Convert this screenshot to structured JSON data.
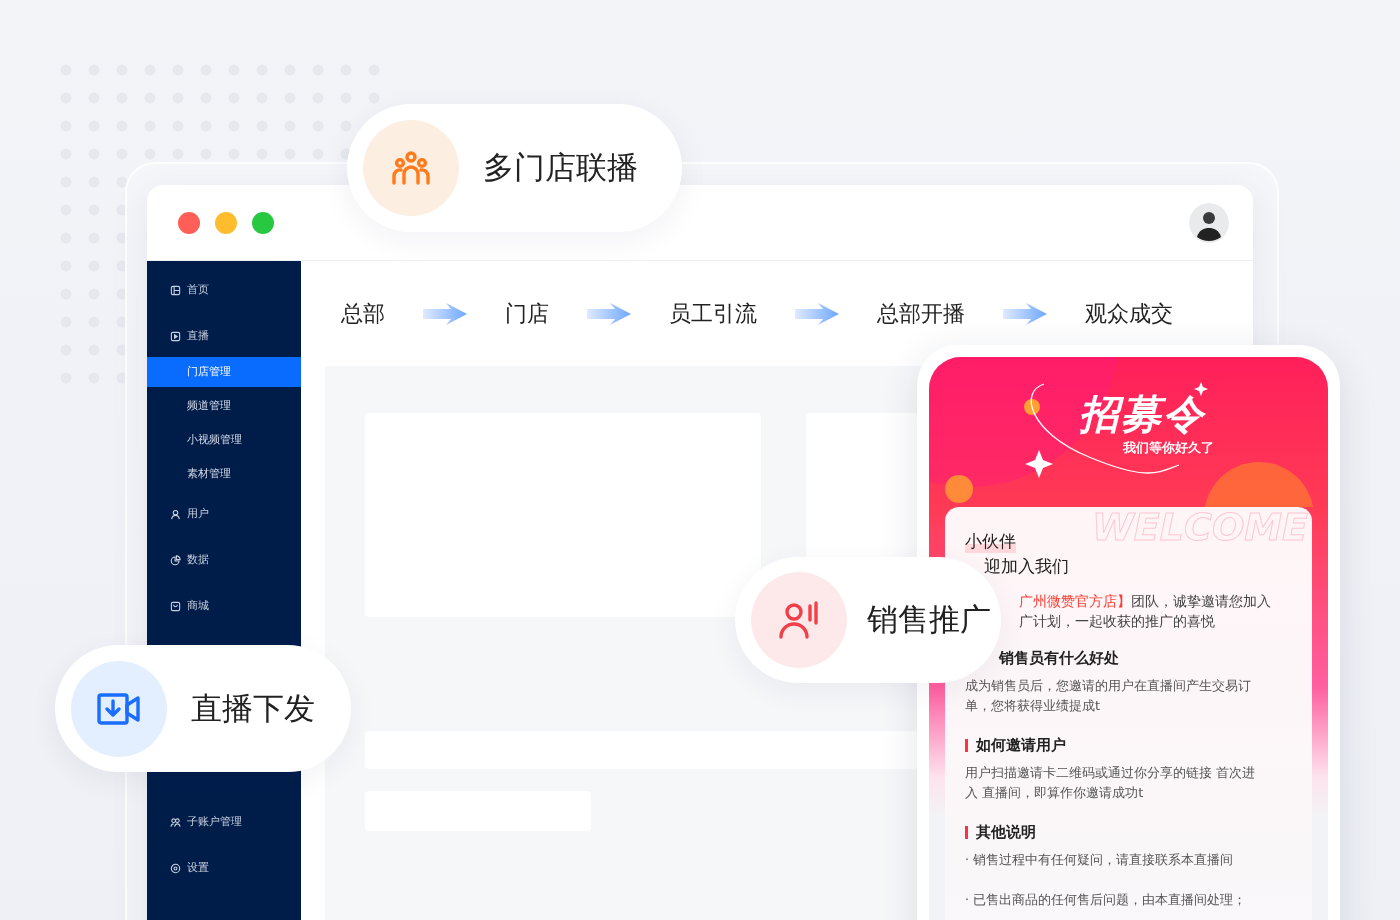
{
  "window": {
    "sidebar": {
      "items": [
        {
          "kind": "home",
          "label": "首页",
          "selected": false
        },
        {
          "kind": "live",
          "label": "直播",
          "selected": false,
          "children": [
            {
              "label": "门店管理",
              "selected": true
            },
            {
              "label": "频道管理",
              "selected": false
            },
            {
              "label": "小视频管理",
              "selected": false
            },
            {
              "label": "素材管理",
              "selected": false
            }
          ]
        },
        {
          "kind": "user",
          "label": "用户",
          "selected": false
        },
        {
          "kind": "chart",
          "label": "数据",
          "selected": false
        },
        {
          "kind": "shop",
          "label": "商城",
          "selected": false
        }
      ],
      "bottom_items": [
        {
          "kind": "accounts",
          "label": "子账户管理",
          "selected": false
        },
        {
          "kind": "settings",
          "label": "设置",
          "selected": false
        }
      ]
    },
    "flow": {
      "steps": [
        "总部",
        "门店",
        "员工引流",
        "总部开播",
        "观众成交"
      ]
    }
  },
  "phone": {
    "header": {
      "title": "招募令",
      "subtitle": "我们等你好久了",
      "watermark": "WELCOME"
    },
    "card": {
      "greeting": "小伙伴",
      "welcome": "迎加入我们",
      "intro": [
        "**广州微赞官方店】**团队，诚挚邀请您加入",
        "广计划，一起收获的推广的喜悦"
      ],
      "sections": [
        {
          "title": "销售员有什么好处",
          "bar": false,
          "body": [
            "成为销售员后，您邀请的用户在直播间产生交易订单，您将获得业绩提成t"
          ]
        },
        {
          "title": "如何邀请用户",
          "bar": true,
          "body": [
            "用户扫描邀请卡二维码或通过你分享的链接 首次进入 直播间，即算作你邀请成功t"
          ]
        },
        {
          "title": "其他说明",
          "bar": true,
          "body": [
            "· 销售过程中有任何疑问，请直接联系本直播间",
            "· 已售出商品的任何售后问题，由本直播间处理；"
          ]
        }
      ]
    }
  },
  "pills": [
    {
      "kind": "stores",
      "label": "多门店联播"
    },
    {
      "kind": "sales",
      "label": "销售推广"
    },
    {
      "kind": "live",
      "label": "直播下发"
    }
  ]
}
